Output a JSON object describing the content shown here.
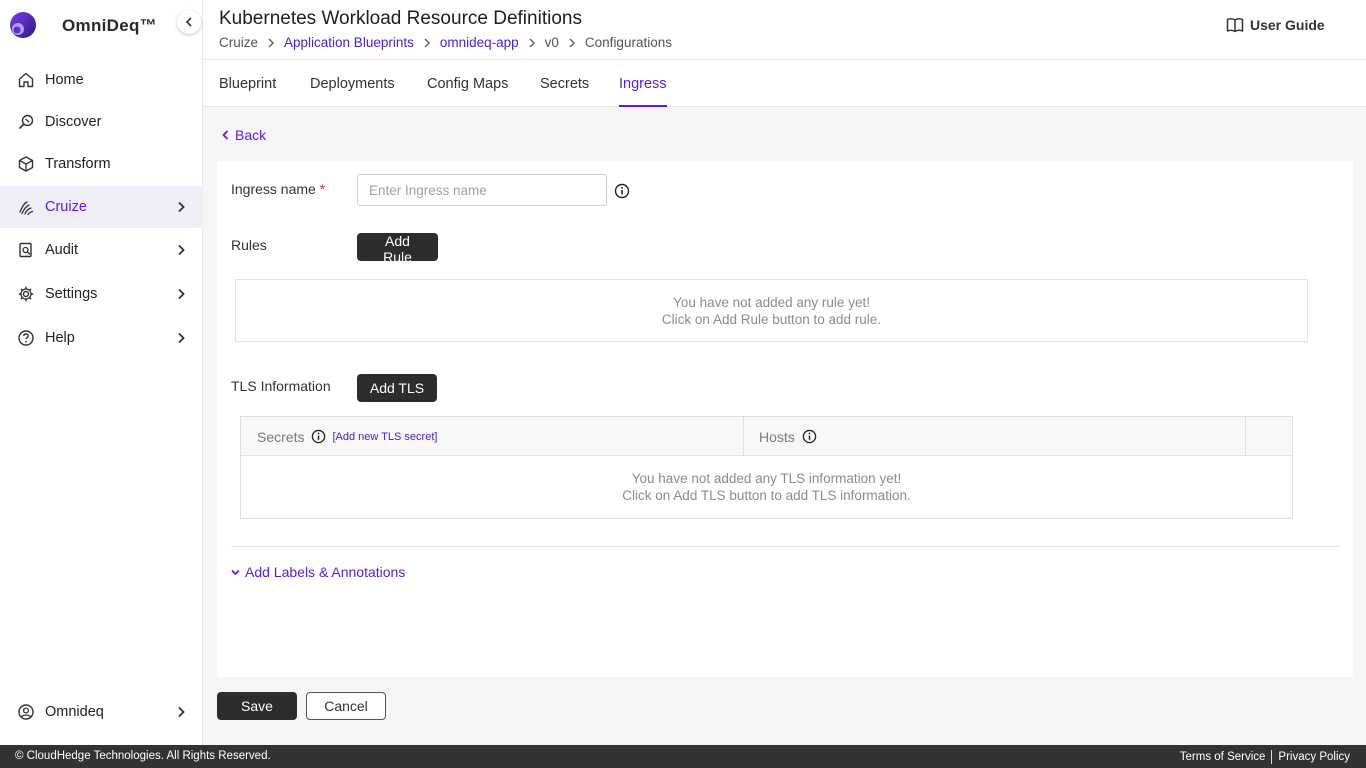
{
  "brand": {
    "name": "OmniDeq™"
  },
  "sidebar": {
    "items": [
      {
        "label": "Home",
        "icon": "home-icon"
      },
      {
        "label": "Discover",
        "icon": "discover-icon"
      },
      {
        "label": "Transform",
        "icon": "cube-icon"
      },
      {
        "label": "Cruize",
        "icon": "fingerprint-icon",
        "active": true
      },
      {
        "label": "Audit",
        "icon": "audit-icon"
      },
      {
        "label": "Settings",
        "icon": "gear-icon"
      },
      {
        "label": "Help",
        "icon": "help-icon"
      }
    ],
    "user": {
      "label": "Omnideq",
      "icon": "user-icon"
    }
  },
  "header": {
    "title": "Kubernetes Workload Resource Definitions",
    "breadcrumb": [
      "Cruize",
      "Application Blueprints",
      "omnideq-app",
      "v0",
      "Configurations"
    ],
    "user_guide": "User Guide"
  },
  "tabs": [
    "Blueprint",
    "Deployments",
    "Config Maps",
    "Secrets",
    "Ingress"
  ],
  "active_tab": "Ingress",
  "back_label": "Back",
  "form": {
    "ingress_name_label": "Ingress name",
    "required_mark": "*",
    "ingress_name_placeholder": "Enter Ingress name",
    "ingress_name_value": "",
    "rules_label": "Rules",
    "add_rule_label": "Add Rule",
    "rules_empty_line1": "You have not added any rule yet!",
    "rules_empty_line2": "Click on Add Rule button to add rule.",
    "tls_label": "TLS Information",
    "add_tls_label": "Add TLS",
    "tls_columns": {
      "secrets": "Secrets",
      "hosts": "Hosts"
    },
    "tls_add_secret_link": "[Add new TLS secret]",
    "tls_empty_line1": "You have not added any TLS information yet!",
    "tls_empty_line2": "Click on Add TLS button to add TLS information.",
    "labels_toggle": "Add Labels & Annotations"
  },
  "actions": {
    "save": "Save",
    "cancel": "Cancel"
  },
  "footer": {
    "copyright": "© CloudHedge Technologies. All Rights Reserved.",
    "terms": "Terms of Service",
    "privacy": "Privacy Policy"
  },
  "colors": {
    "accent": "#5a1ee0",
    "dark_button": "#2d2d2d",
    "footer_bg": "#333333"
  }
}
